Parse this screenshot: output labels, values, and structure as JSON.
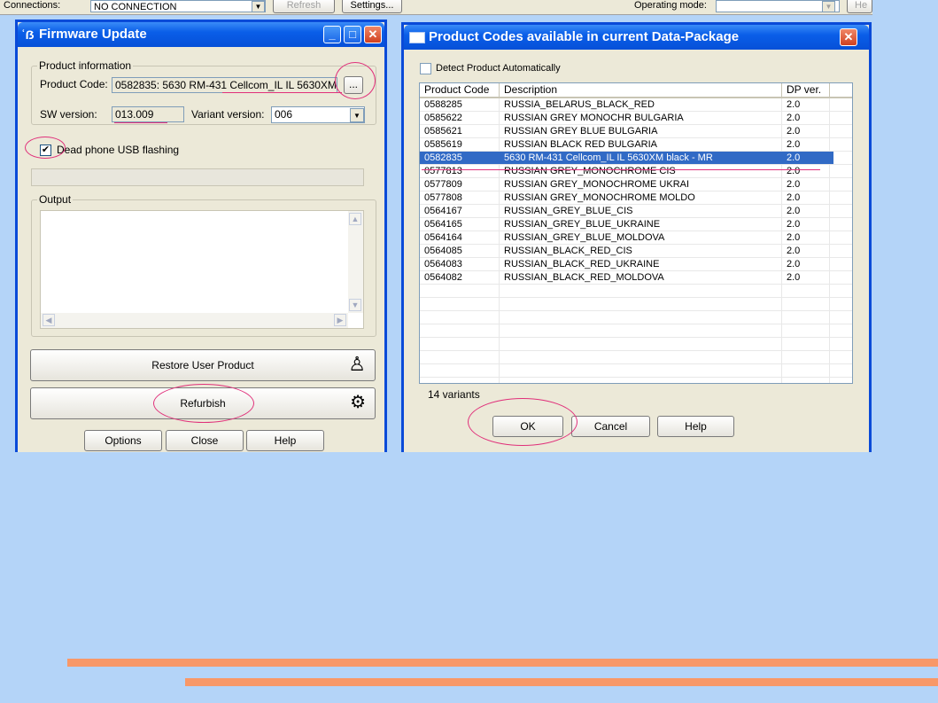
{
  "topbar": {
    "connections_label": "Connections:",
    "connections_value": "NO CONNECTION",
    "refresh_label": "Refresh",
    "settings_label": "Settings...",
    "operating_mode_label": "Operating mode:",
    "help_partial": "He"
  },
  "firmware": {
    "title": "Firmware Update",
    "product_info_label": "Product information",
    "product_code_label": "Product Code:",
    "product_code_value": "0582835: 5630 RM-431 Cellcom_IL IL 5630XM",
    "browse_label": "...",
    "sw_version_label": "SW version:",
    "sw_version_value": "013.009",
    "variant_label": "Variant version:",
    "variant_value": "006",
    "dead_phone_label": "Dead phone USB flashing",
    "output_label": "Output",
    "restore_label": "Restore User Product",
    "refurbish_label": "Refurbish",
    "options_label": "Options",
    "close_label": "Close",
    "help_label": "Help"
  },
  "codes": {
    "title": "Product Codes available in current Data-Package",
    "detect_label": "Detect Product Automatically",
    "columns": [
      "Product Code",
      "Description",
      "DP ver."
    ],
    "rows": [
      [
        "0588285",
        "RUSSIA_BELARUS_BLACK_RED",
        "2.0"
      ],
      [
        "0585622",
        "RUSSIAN GREY MONOCHR BULGARIA",
        "2.0"
      ],
      [
        "0585621",
        "RUSSIAN GREY BLUE BULGARIA",
        "2.0"
      ],
      [
        "0585619",
        "RUSSIAN BLACK RED BULGARIA",
        "2.0"
      ],
      [
        "0582835",
        "5630 RM-431 Cellcom_IL IL 5630XM black - MR",
        "2.0"
      ],
      [
        "0577813",
        "RUSSIAN GREY_MONOCHROME CIS",
        "2.0"
      ],
      [
        "0577809",
        "RUSSIAN GREY_MONOCHROME UKRAI",
        "2.0"
      ],
      [
        "0577808",
        "RUSSIAN GREY_MONOCHROME MOLDO",
        "2.0"
      ],
      [
        "0564167",
        "RUSSIAN_GREY_BLUE_CIS",
        "2.0"
      ],
      [
        "0564165",
        "RUSSIAN_GREY_BLUE_UKRAINE",
        "2.0"
      ],
      [
        "0564164",
        "RUSSIAN_GREY_BLUE_MOLDOVA",
        "2.0"
      ],
      [
        "0564085",
        "RUSSIAN_BLACK_RED_CIS",
        "2.0"
      ],
      [
        "0564083",
        "RUSSIAN_BLACK_RED_UKRAINE",
        "2.0"
      ],
      [
        "0564082",
        "RUSSIAN_BLACK_RED_MOLDOVA",
        "2.0"
      ]
    ],
    "selected_index": 4,
    "variants_label": "14 variants",
    "ok_label": "OK",
    "cancel_label": "Cancel",
    "help_label": "Help"
  },
  "colors": {
    "background": "#b4d4f8",
    "titlebar": "#0a5ee8",
    "selection": "#316ac5",
    "annotation": "#e0307a",
    "accent_bars": "#f89868"
  },
  "icons": [
    "window-app-icon",
    "minimize-icon",
    "maximize-icon",
    "close-icon",
    "user-icon",
    "factory-icon",
    "checkmark-icon"
  ]
}
